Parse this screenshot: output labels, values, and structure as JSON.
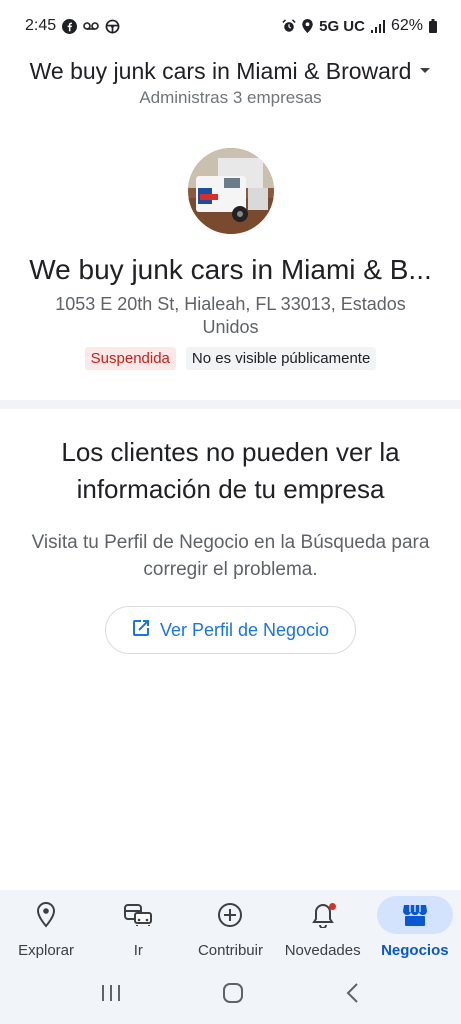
{
  "status_bar": {
    "time": "2:45",
    "network": "5G UC",
    "battery": "62%",
    "left_icons": [
      "facebook-icon",
      "voicemail-icon",
      "steering-wheel-icon"
    ],
    "right_icons": [
      "alarm-icon",
      "location-icon",
      "signal-icon",
      "battery-icon"
    ]
  },
  "header": {
    "title": "We buy junk cars in Miami & Broward",
    "subtitle": "Administras 3 empresas"
  },
  "business": {
    "name": "We buy junk cars in Miami & B...",
    "address": "1053 E 20th St, Hialeah, FL 33013, Estados Unidos",
    "badge_status": "Suspendida",
    "badge_visibility": "No es visible públicamente"
  },
  "notice": {
    "title": "Los clientes no pueden ver la información de tu empresa",
    "body": "Visita tu Perfil de Negocio en la Búsqueda para corregir el problema.",
    "button_label": "Ver Perfil de Negocio"
  },
  "bottom_nav": {
    "items": [
      {
        "label": "Explorar",
        "icon": "location-pin-icon"
      },
      {
        "label": "Ir",
        "icon": "commute-icon"
      },
      {
        "label": "Contribuir",
        "icon": "add-circle-icon"
      },
      {
        "label": "Novedades",
        "icon": "bell-icon"
      },
      {
        "label": "Negocios",
        "icon": "storefront-icon"
      }
    ],
    "active": "Negocios"
  },
  "colors": {
    "accent": "#1a73e8",
    "active_nav": "#0b57d0",
    "suspended_text": "#c5221f",
    "suspended_bg": "#fce8e6"
  }
}
